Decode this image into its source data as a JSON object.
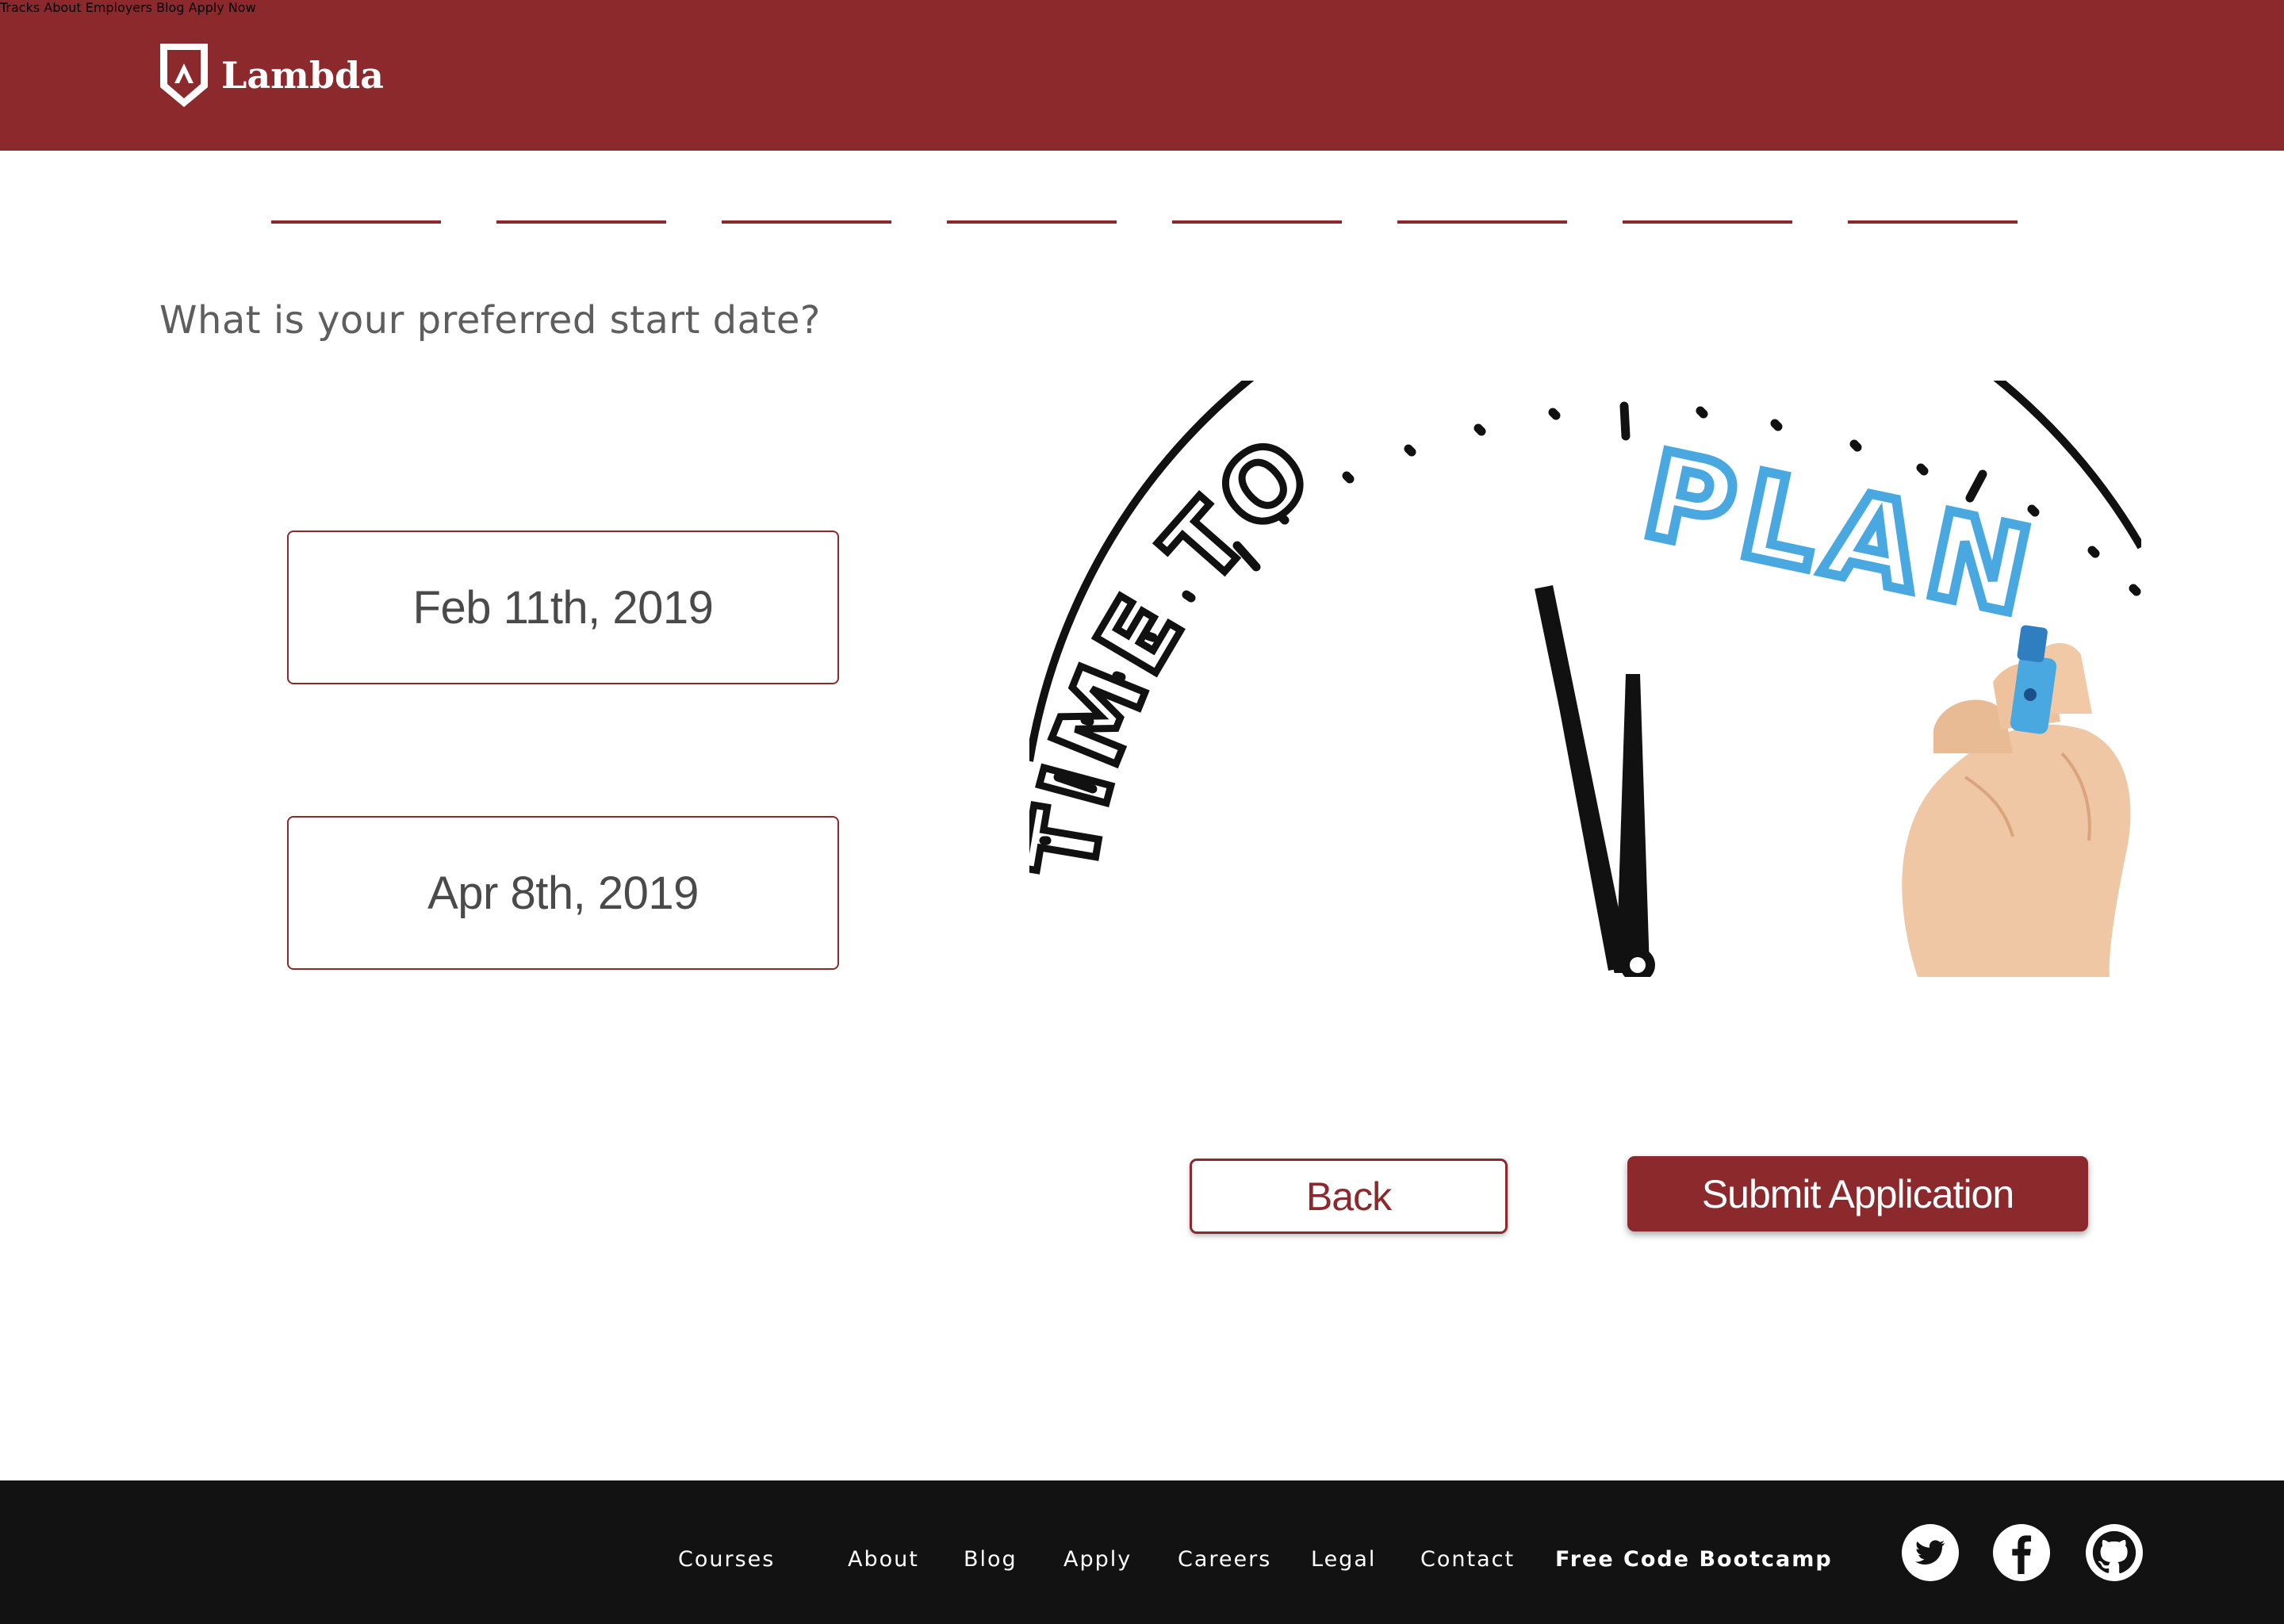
{
  "header": {
    "brand": "Lambda",
    "nav": [
      "Tracks",
      "About",
      "Employers",
      "Blog",
      "Apply Now"
    ]
  },
  "progress": {
    "steps_total": 8
  },
  "question": "What is your preferred start date?",
  "options": [
    "Feb 11th, 2019",
    "Apr 8th, 2019"
  ],
  "hero": {
    "text_dark": "TIME TO",
    "text_blue": "PLAN"
  },
  "buttons": {
    "back": "Back",
    "submit": "Submit Application"
  },
  "footer": {
    "links": [
      "Courses",
      "About",
      "Blog",
      "Apply",
      "Careers",
      "Legal",
      "Contact",
      "Free Code Bootcamp"
    ],
    "social": [
      "twitter-icon",
      "facebook-icon",
      "github-icon"
    ]
  },
  "colors": {
    "brand": "#8b292d",
    "footer_bg": "#121212",
    "plan_blue": "#4aa8e0"
  }
}
